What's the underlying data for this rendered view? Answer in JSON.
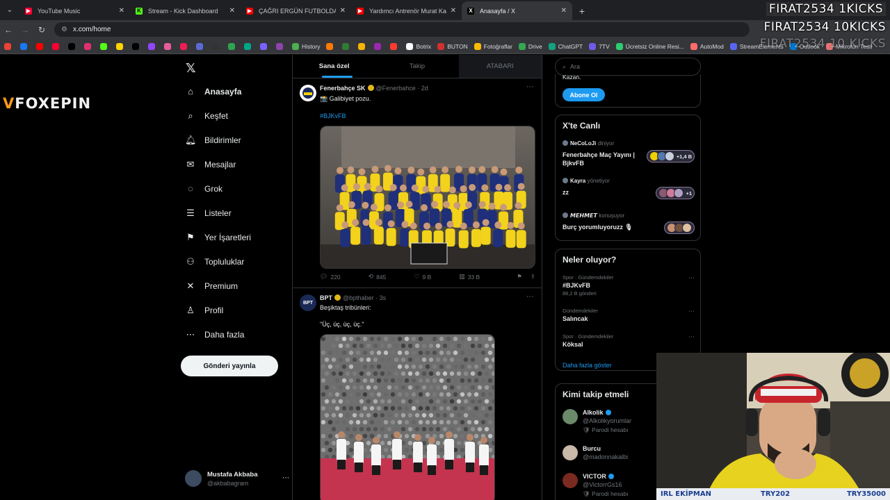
{
  "browser": {
    "tabs": [
      {
        "title": "YouTube Music",
        "color": "#ff0033",
        "glyph": "▶",
        "active": false
      },
      {
        "title": "Stream - Kick Dashboard",
        "color": "#53fc18",
        "glyph": "K",
        "active": false
      },
      {
        "title": "ÇAĞRI ERGÜN FUTBOLDA NE K",
        "color": "#ff0000",
        "glyph": "▶",
        "active": false
      },
      {
        "title": "Yardımcı Antrenör Murat Kaytaz",
        "color": "#ff0000",
        "glyph": "▶",
        "active": false
      },
      {
        "title": "Anasayfa / X",
        "color": "#000000",
        "glyph": "X",
        "active": true
      }
    ],
    "url": "x.com/home",
    "bookmarks": [
      "",
      "",
      "",
      "",
      "",
      "",
      "",
      "",
      "",
      "",
      "",
      "",
      "",
      "",
      "",
      "",
      "",
      "",
      "History",
      "",
      "",
      "",
      "",
      "",
      "Botrix",
      "BUTON",
      "Fotoğraflar",
      "Drive",
      "ChatGPT",
      "7TV",
      "Ücretsiz Online Resi...",
      "AutoMod",
      "StreamElements",
      "Outlook",
      "Mikrofon Testi"
    ]
  },
  "overlay": {
    "line1": "FIRAT2534  1KICKS",
    "line2": "FIRAT2534  10KICKS",
    "line3": "FIRAT2534  10 KICKS"
  },
  "stream_logo": {
    "prefix": "V",
    "name": "FOXEPIN"
  },
  "nav": {
    "items": [
      {
        "label": "Anasayfa",
        "icon": "⌂",
        "name": "home"
      },
      {
        "label": "Keşfet",
        "icon": "⌕",
        "name": "explore"
      },
      {
        "label": "Bildirimler",
        "icon": "🔔︎",
        "name": "notifications"
      },
      {
        "label": "Mesajlar",
        "icon": "✉",
        "name": "messages"
      },
      {
        "label": "Grok",
        "icon": "◌",
        "name": "grok"
      },
      {
        "label": "Listeler",
        "icon": "☰",
        "name": "lists"
      },
      {
        "label": "Yer İşaretleri",
        "icon": "⚑",
        "name": "bookmarks"
      },
      {
        "label": "Topluluklar",
        "icon": "⚇",
        "name": "communities"
      },
      {
        "label": "Premium",
        "icon": "✕",
        "name": "premium"
      },
      {
        "label": "Profil",
        "icon": "♙",
        "name": "profile"
      },
      {
        "label": "Daha fazla",
        "icon": "⋯",
        "name": "more"
      }
    ],
    "post_button": "Gönderi yayınla",
    "user": {
      "name": "Mustafa Akbaba",
      "handle": "@akbabagram"
    }
  },
  "timeline": {
    "tabs": [
      "Sana özel",
      "Takip",
      "ATABARI"
    ],
    "tweets": [
      {
        "name": "Fenerbahçe SK",
        "handle": "@Fenerbahce · 2d",
        "text": "📸 Galibiyet pozu.",
        "hashtag": "#BJKvFB",
        "replies": "220",
        "retweets": "845",
        "likes": "9 B",
        "views": "33 B"
      },
      {
        "name": "BPT",
        "handle": "@bpthaber · 3s",
        "text": "Beşiktaş tribünleri:",
        "quote": "\"Üç, üç, üç, üç.\""
      }
    ]
  },
  "sidebar": {
    "search_placeholder": "Ara",
    "premium": {
      "kazan": "Kazan.",
      "subscribe": "Abone Ol"
    },
    "live": {
      "title": "X'te Canlı",
      "items": [
        {
          "host": "NeCoLoJi",
          "role": "diniyor",
          "title": "Fenerbahçe Maç Yayını | BjkvFB",
          "count": "+1,4 B"
        },
        {
          "host": "Kayra",
          "role": "yönetiyor",
          "title": "zz",
          "count": "+1"
        },
        {
          "host": "𝙈𝙀𝙃𝙈𝙀𝙏",
          "role": "konuşuyor",
          "title": "Burç yorumluyoruzz 🎙",
          "count": ""
        }
      ]
    },
    "trends": {
      "title": "Neler oluyor?",
      "items": [
        {
          "meta": "Spor · Gündemdekiler",
          "topic": "#BJKvFB",
          "count": "88,2 B gönderi"
        },
        {
          "meta": "Gündemdekiler",
          "topic": "Salıncak",
          "count": ""
        },
        {
          "meta": "Spor · Gündemdekiler",
          "topic": "Köksal",
          "count": ""
        }
      ],
      "more": "Daha fazla göster"
    },
    "follow": {
      "title": "Kimi takip etmeli",
      "items": [
        {
          "name": "Alkolik",
          "handle": "@Alkolikyorumlar",
          "tag": "🛡 Parodi hesabı",
          "verified": true
        },
        {
          "name": "Burcu",
          "handle": "@madonnakalbi",
          "tag": "",
          "verified": false
        },
        {
          "name": "VICTOR",
          "handle": "@VictorrGs16",
          "tag": "🛡 Parodi hesabı",
          "verified": true
        }
      ]
    }
  },
  "webcam_bar": {
    "left": "IRL EKİPMAN",
    "mid": "TRY202",
    "right": "TRY35000"
  }
}
